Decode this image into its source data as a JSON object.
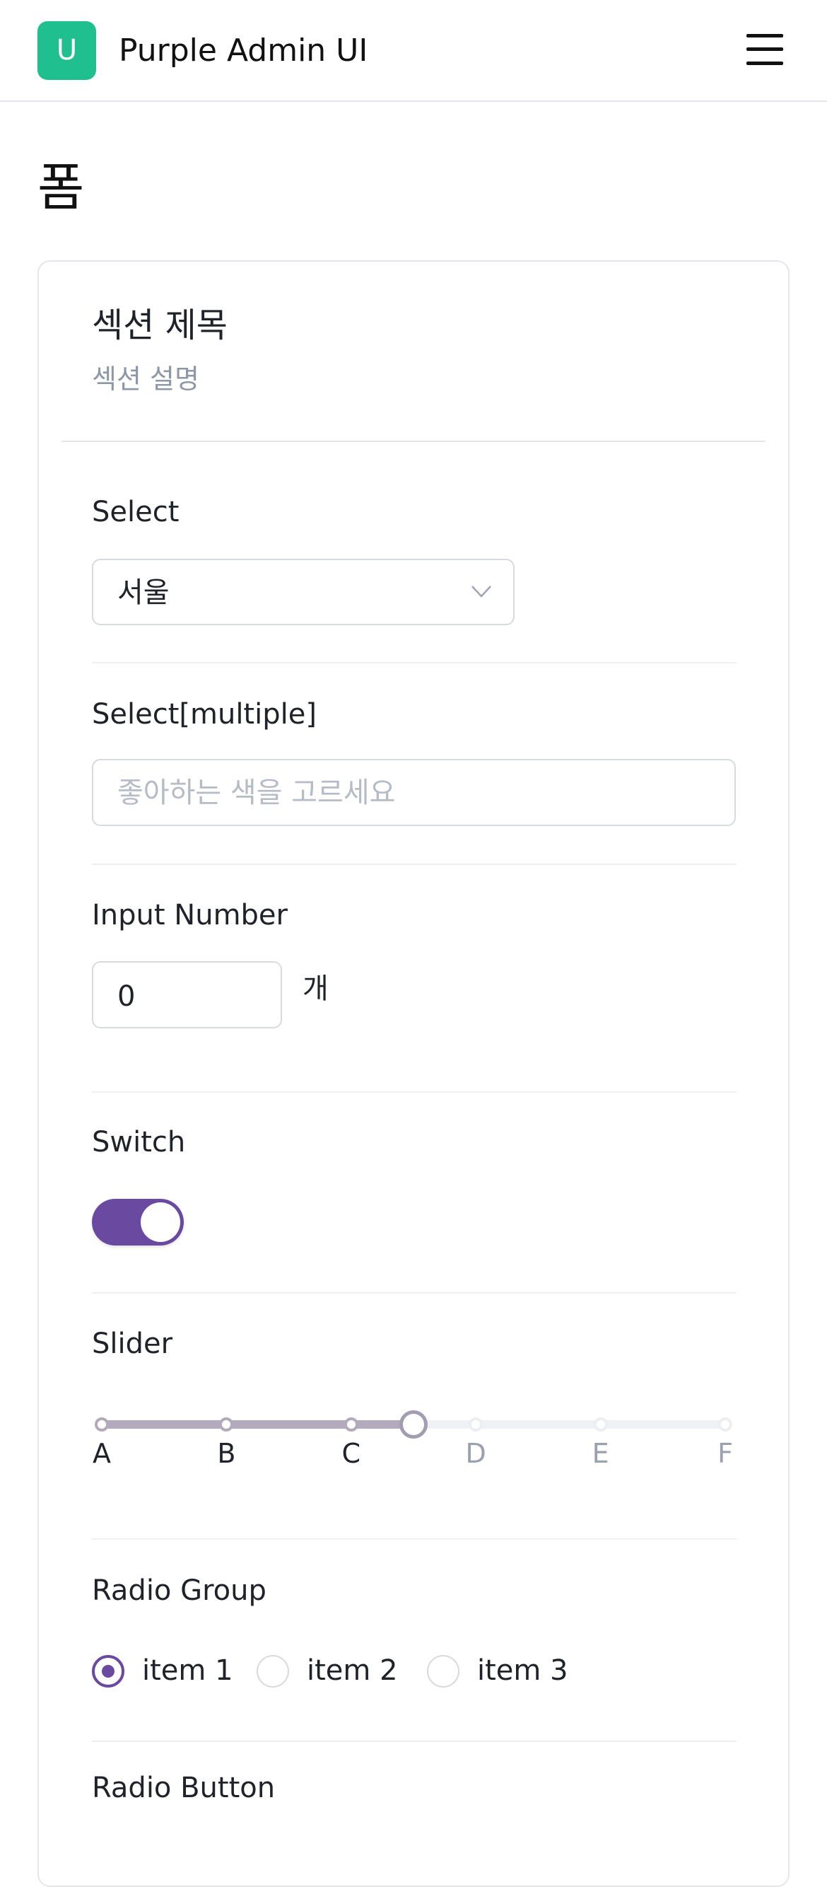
{
  "header": {
    "logo_letter": "U",
    "app_title": "Purple Admin UI",
    "menu_icon": "hamburger-icon"
  },
  "page": {
    "title": "폼"
  },
  "section": {
    "title": "섹션 제목",
    "description": "섹션 설명"
  },
  "fields": {
    "select": {
      "label": "Select",
      "value": "서울",
      "icon": "chevron-down-icon"
    },
    "multi_select": {
      "label": "Select[multiple]",
      "placeholder": "좋아하는 색을 고르세요"
    },
    "input_number": {
      "label": "Input Number",
      "value": "0",
      "unit": "개"
    },
    "switch": {
      "label": "Switch",
      "checked": true
    },
    "slider": {
      "label": "Slider",
      "marks": [
        "A",
        "B",
        "C",
        "D",
        "E",
        "F"
      ],
      "value": 2.5
    },
    "radio_group": {
      "label": "Radio Group",
      "options": [
        "item 1",
        "item 2",
        "item 3"
      ],
      "selected": "item 1"
    },
    "radio_button": {
      "label": "Radio Button"
    }
  },
  "colors": {
    "brand": "#1fbf8f",
    "accent": "#6a4aa0"
  }
}
